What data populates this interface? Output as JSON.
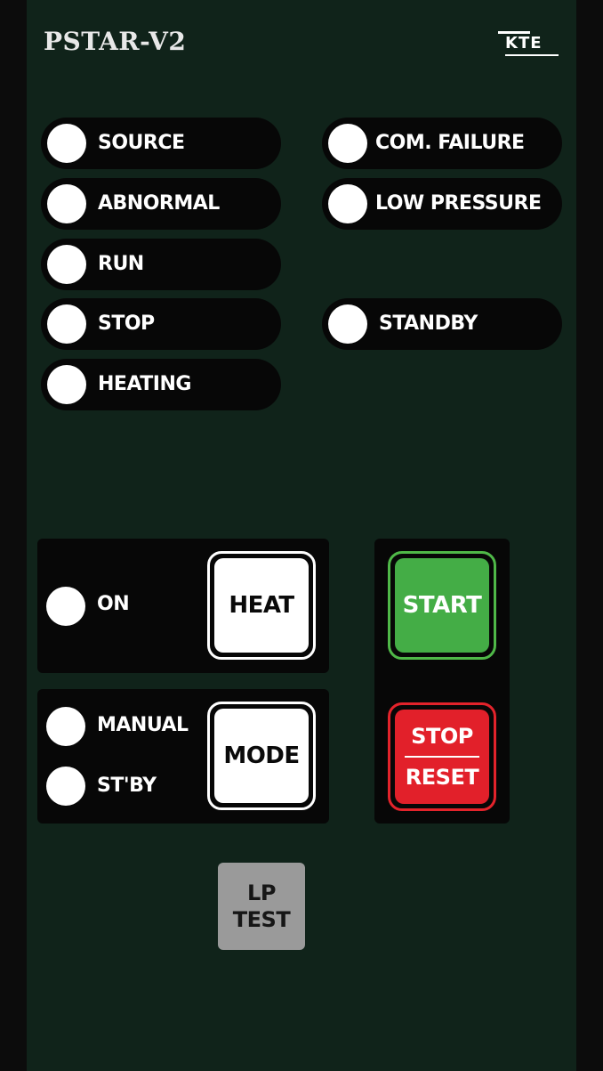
{
  "header": {
    "title": "PSTAR-V2",
    "logo_text": "KTE"
  },
  "indicators": {
    "source": "SOURCE",
    "abnormal": "ABNORMAL",
    "run": "RUN",
    "stop": "STOP",
    "heating": "HEATING",
    "com_failure": "COM. FAILURE",
    "low_pressure": "LOW PRESSURE",
    "standby": "STANDBY"
  },
  "heat_group": {
    "on_label": "ON",
    "button_label": "HEAT"
  },
  "mode_group": {
    "manual_label": "MANUAL",
    "stby_label": "ST'BY",
    "button_label": "MODE"
  },
  "controls": {
    "start_label": "START",
    "stop_label": "STOP",
    "reset_label": "RESET"
  },
  "lp_test": {
    "line1": "LP",
    "line2": "TEST"
  },
  "colors": {
    "panel": "#10231a",
    "start": "#44ad46",
    "stop_reset": "#e2202a",
    "lp_test": "#9a9a9a",
    "led_off": "#ffffff"
  }
}
